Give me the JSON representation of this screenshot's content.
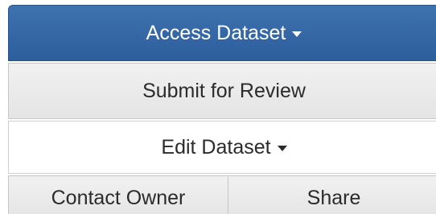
{
  "actions": {
    "access_dataset": "Access Dataset",
    "submit_for_review": "Submit for Review",
    "edit_dataset": "Edit Dataset",
    "contact_owner": "Contact Owner",
    "share": "Share"
  },
  "colors": {
    "primary": "#3a6ba8",
    "default_bg": "#e8e8e8",
    "white_bg": "#ffffff"
  },
  "icons": {
    "dropdown": "caret-down-icon"
  }
}
